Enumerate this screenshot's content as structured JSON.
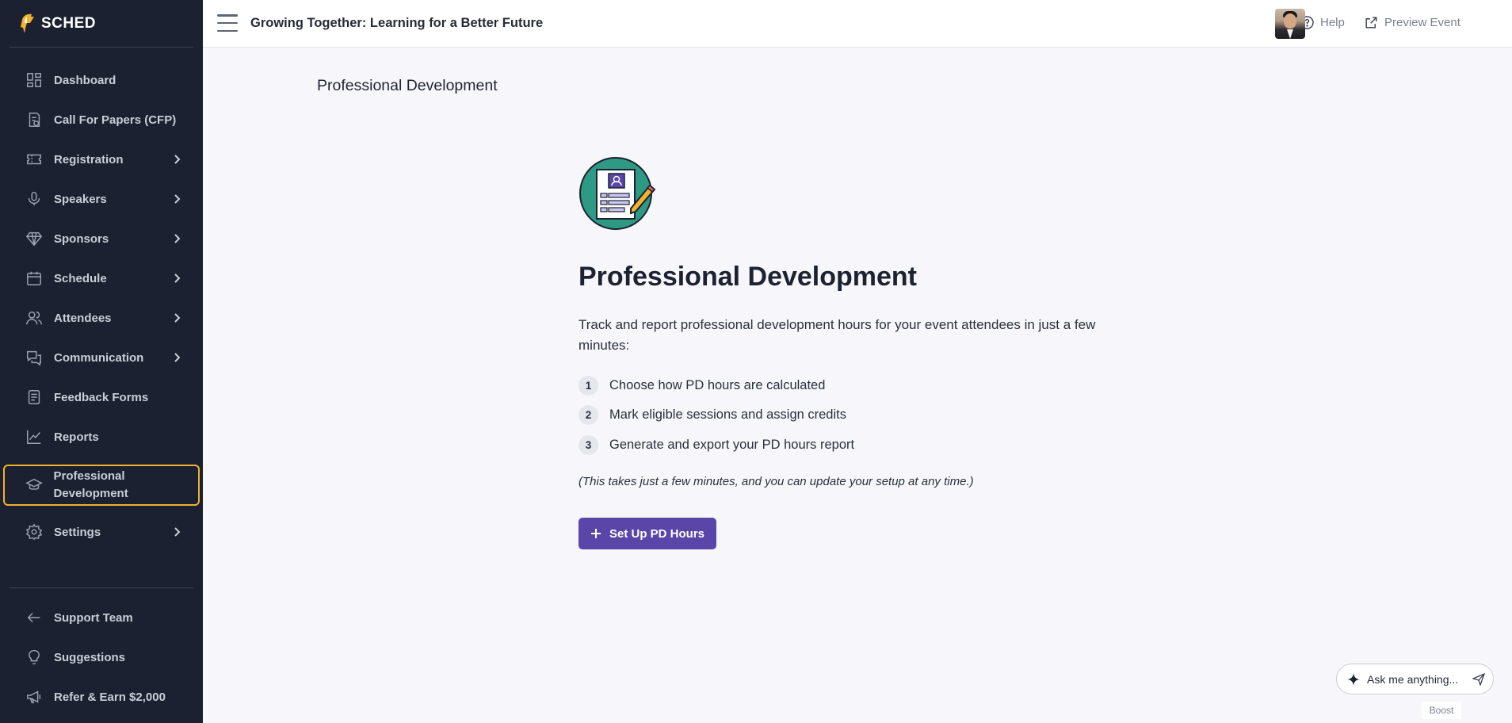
{
  "app": {
    "logo_text": "SCHED"
  },
  "header": {
    "event_title": "Growing Together: Learning for a Better Future",
    "help_label": "Help",
    "preview_label": "Preview Event"
  },
  "sidebar": {
    "items": [
      {
        "label": "Dashboard",
        "icon": "dashboard-icon",
        "has_submenu": false
      },
      {
        "label": "Call For Papers (CFP)",
        "icon": "cfp-icon",
        "has_submenu": false
      },
      {
        "label": "Registration",
        "icon": "ticket-icon",
        "has_submenu": true
      },
      {
        "label": "Speakers",
        "icon": "microphone-icon",
        "has_submenu": true
      },
      {
        "label": "Sponsors",
        "icon": "diamond-icon",
        "has_submenu": true
      },
      {
        "label": "Schedule",
        "icon": "calendar-icon",
        "has_submenu": true
      },
      {
        "label": "Attendees",
        "icon": "users-icon",
        "has_submenu": true
      },
      {
        "label": "Communication",
        "icon": "chat-icon",
        "has_submenu": true
      },
      {
        "label": "Feedback Forms",
        "icon": "form-icon",
        "has_submenu": false
      },
      {
        "label": "Reports",
        "icon": "chart-icon",
        "has_submenu": false
      },
      {
        "label": "Professional Development",
        "icon": "graduation-cap-icon",
        "has_submenu": false,
        "active": true
      },
      {
        "label": "Settings",
        "icon": "gear-icon",
        "has_submenu": true
      }
    ],
    "footer_items": [
      {
        "label": "Support Team",
        "icon": "arrow-left-icon"
      },
      {
        "label": "Suggestions",
        "icon": "lightbulb-icon"
      },
      {
        "label": "Refer & Earn $2,000",
        "icon": "megaphone-icon"
      }
    ]
  },
  "main": {
    "page_heading": "Professional Development",
    "title": "Professional Development",
    "description": "Track and report professional development hours for your event attendees in just a few minutes:",
    "steps": [
      {
        "num": "1",
        "text": "Choose how PD hours are calculated"
      },
      {
        "num": "2",
        "text": "Mark eligible sessions and assign credits"
      },
      {
        "num": "3",
        "text": "Generate and export your PD hours report"
      }
    ],
    "note": "(This takes just a few minutes, and you can update your setup at any time.)",
    "cta_label": "Set Up PD Hours"
  },
  "assistant": {
    "placeholder": "Ask me anything...",
    "boost_label": "Boost"
  },
  "colors": {
    "sidebar_bg": "#1b2130",
    "active_outline": "#f2b12e",
    "primary": "#5a45a8",
    "illustration_teal": "#2e9a84"
  }
}
